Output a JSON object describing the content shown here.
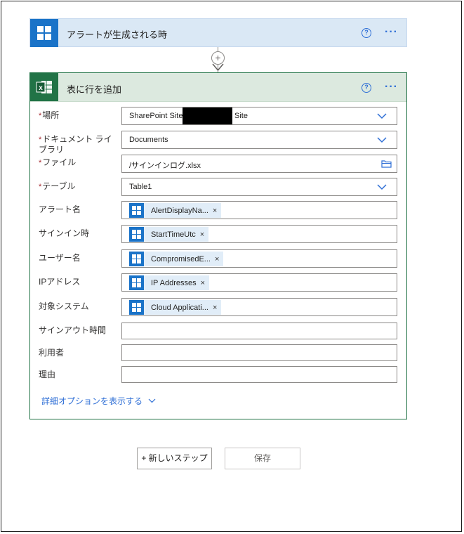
{
  "trigger": {
    "title": "アラートが生成される時",
    "icon": "windows-grid-icon",
    "help": "?",
    "more": "···"
  },
  "connector": {
    "add": "+"
  },
  "action": {
    "title": "表に行を追加",
    "icon": "excel-icon",
    "help": "?",
    "more": "···",
    "fields": {
      "location": {
        "label": "場所",
        "required": "*",
        "value_prefix": "SharePoint Site",
        "value_suffix": "Site"
      },
      "library": {
        "label": "ドキュメント ライブラリ",
        "required": "*",
        "value": "Documents"
      },
      "file": {
        "label": "ファイル",
        "required": "*",
        "value": "/サインインログ.xlsx"
      },
      "table": {
        "label": "テーブル",
        "required": "*",
        "value": "Table1"
      },
      "alert_name": {
        "label": "アラート名",
        "token": "AlertDisplayNa...",
        "remove": "×"
      },
      "signin_time": {
        "label": "サインイン時",
        "token": "StartTimeUtc",
        "remove": "×"
      },
      "user_name": {
        "label": "ユーザー名",
        "token": "CompromisedE...",
        "remove": "×"
      },
      "ip_address": {
        "label": "IPアドレス",
        "token": "IP Addresses",
        "remove": "×"
      },
      "target_system": {
        "label": "対象システム",
        "token": "Cloud Applicati...",
        "remove": "×"
      },
      "signout_time": {
        "label": "サインアウト時間",
        "value": ""
      },
      "user": {
        "label": "利用者",
        "value": ""
      },
      "reason": {
        "label": "理由",
        "value": ""
      }
    },
    "advanced_options": "詳細オプションを表示する"
  },
  "buttons": {
    "new_step": "+ 新しいステップ",
    "save": "保存"
  },
  "colors": {
    "trigger_bg": "#dae8f5",
    "trigger_icon_bg": "#1a73c8",
    "action_border": "#217346",
    "action_header_bg": "#dce9df",
    "link_blue": "#2f6fd6",
    "token_bg": "#e1edf8"
  }
}
